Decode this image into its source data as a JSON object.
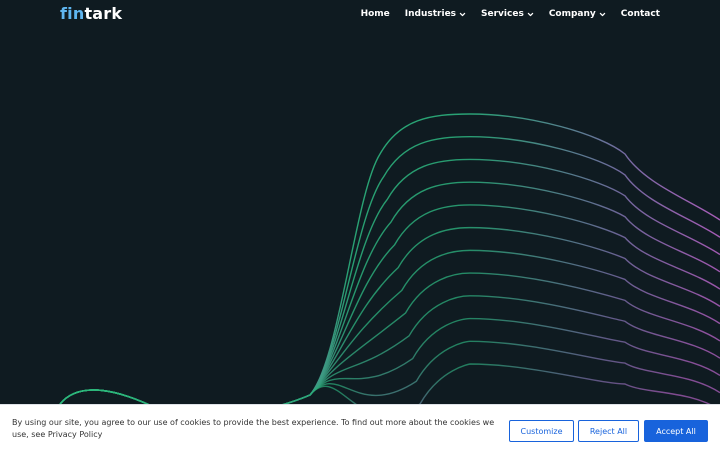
{
  "header": {
    "logo_part1": "fin",
    "logo_part2": "tark",
    "nav": [
      {
        "label": "Home",
        "dropdown": false
      },
      {
        "label": "Industries",
        "dropdown": true
      },
      {
        "label": "Services",
        "dropdown": true
      },
      {
        "label": "Company",
        "dropdown": true
      },
      {
        "label": "Contact",
        "dropdown": false
      }
    ]
  },
  "cookie_banner": {
    "text": "By using our site, you agree to our use of cookies to provide the best experience. To find out more about the cookies we use, see",
    "link_text": "Privacy Policy",
    "customize_label": "Customize",
    "reject_label": "Reject All",
    "accept_label": "Accept All"
  },
  "colors": {
    "background": "#0f1b21",
    "brand_blue": "#5fb6f0",
    "wave_green": "#2ec27e",
    "wave_purple": "#b060c0",
    "button_blue": "#1863dc"
  }
}
